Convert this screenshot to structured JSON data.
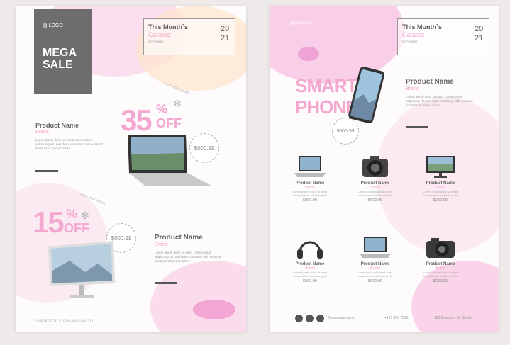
{
  "left": {
    "logo": "LOGO",
    "mega": "MEGA",
    "sale": "SALE",
    "catalog_title": "This Month`s",
    "catalog_sub": "Catalog",
    "catalog_tiny": "SEPTEMBER",
    "year_top": "20",
    "year_bottom": "21",
    "promo1": {
      "percent": "35",
      "pct_sign": "%",
      "off": "OFF",
      "product": "Product Name",
      "brand": "Brand",
      "lorem": "Lorem ipsum dolor sit amet, consectetuer adipiscing elit, sed diam nonummy nibh euismod tincidunt ut laoreet dolore.",
      "price": "$000.99",
      "curve": "SHOP NOW ONLINE"
    },
    "promo2": {
      "percent": "15",
      "pct_sign": "%",
      "off": "OFF",
      "product": "Product Name",
      "brand": "Brand",
      "lorem": "Lorem ipsum dolor sit amet, consectetuer adipiscing elit, sed diam nonummy nibh euismod tincidunt ut laoreet dolore.",
      "price": "$000.99",
      "curve": "SHOP NOW ONLINE"
    },
    "footnote": "* SUBJECT TO STOCK AVAILABILITY"
  },
  "right": {
    "logo": "LOGO",
    "catalog_title": "This Month`s",
    "catalog_sub": "Catalog",
    "catalog_tiny": "SEPTEMBER",
    "year_top": "20",
    "year_bottom": "21",
    "smart": "SMART",
    "phone": "PHONE",
    "price_badge": "$000.99",
    "featured": {
      "product": "Product Name",
      "brand": "Brand",
      "lorem": "Lorem ipsum dolor sit amet, consectetuer adipiscing elit, sed diam nonummy nibh euismod tincidunt ut laoreet dolore."
    },
    "grid": [
      {
        "name": "Product Name",
        "brand": "Brand",
        "desc": "Lorem ipsum dolor sit amet consectetuer adipiscing elit",
        "price": "$000.99",
        "icon": "laptop-icon"
      },
      {
        "name": "Product Name",
        "brand": "Brand",
        "desc": "Lorem ipsum dolor sit amet consectetuer adipiscing elit",
        "price": "$000.99",
        "icon": "camera-icon"
      },
      {
        "name": "Product Name",
        "brand": "Brand",
        "desc": "Lorem ipsum dolor sit amet consectetuer adipiscing elit",
        "price": "$000.99",
        "icon": "monitor-icon"
      },
      {
        "name": "Product Name",
        "brand": "Brand",
        "desc": "Lorem ipsum dolor sit amet consectetuer adipiscing elit",
        "price": "$000.99",
        "icon": "headphones-icon"
      },
      {
        "name": "Product Name",
        "brand": "Brand",
        "desc": "Lorem ipsum dolor sit amet consectetuer adipiscing elit",
        "price": "$000.99",
        "icon": "laptop-icon"
      },
      {
        "name": "Product Name",
        "brand": "Brand",
        "desc": "Lorem ipsum dolor sit amet consectetuer adipiscing elit",
        "price": "$000.99",
        "icon": "dslr-camera-icon"
      }
    ],
    "footer": {
      "social": "@companyname",
      "phone": "+123 456 7890",
      "address": "123 Business St. Street"
    }
  },
  "colors": {
    "pink": "#f4a7cf",
    "dark": "#6a6a6a"
  }
}
